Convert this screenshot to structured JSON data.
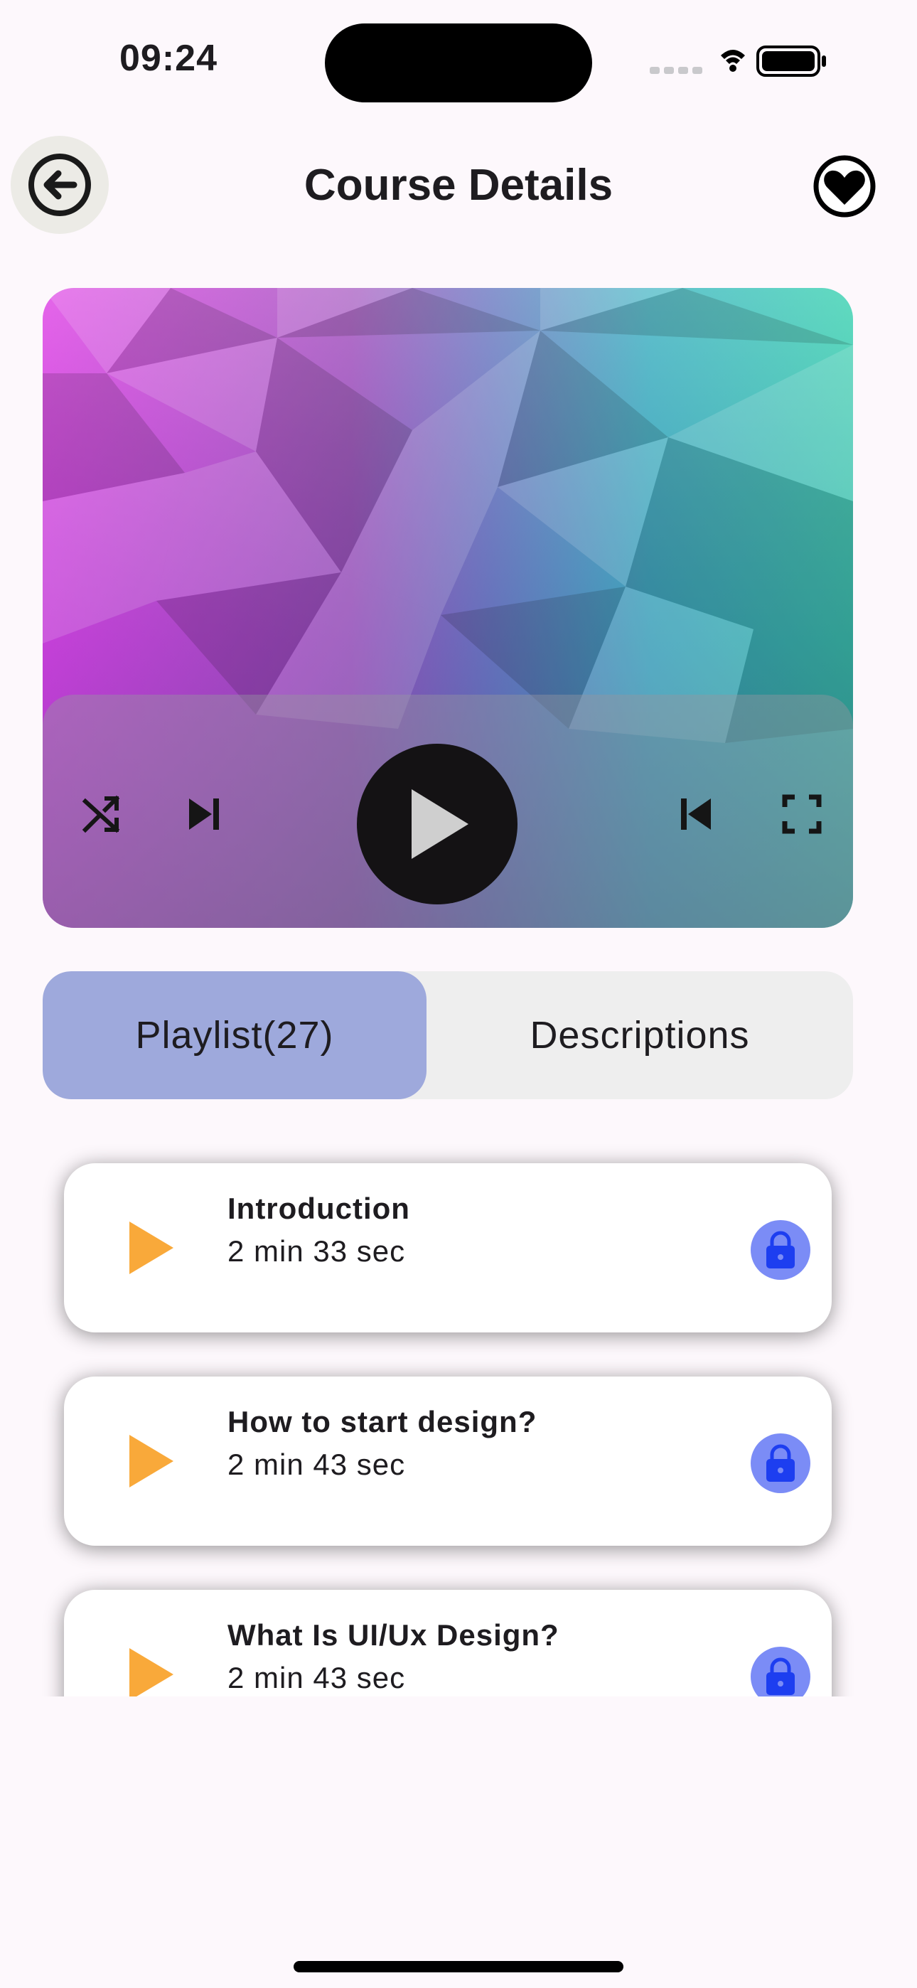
{
  "status_bar": {
    "time": "09:24"
  },
  "header": {
    "title": "Course Details"
  },
  "tabs": [
    {
      "label": "Playlist(27)",
      "active": true
    },
    {
      "label": "Descriptions",
      "active": false
    }
  ],
  "lessons": [
    {
      "title": "Introduction",
      "duration": "2 min 33 sec",
      "locked": true
    },
    {
      "title": "How to start design?",
      "duration": "2 min 43 sec",
      "locked": true
    },
    {
      "title": "What Is UI/Ux Design?",
      "duration": "2 min 43 sec",
      "locked": true
    }
  ],
  "icons": {
    "back": "arrow-left-circle-icon",
    "favorite": "heart-icon",
    "shuffle": "shuffle-icon",
    "skip_next": "skip-next-icon",
    "play": "play-icon",
    "skip_previous": "skip-previous-icon",
    "fullscreen": "fullscreen-icon",
    "lock": "lock-icon"
  },
  "colors": {
    "background": "#fdf8fc",
    "tab_active": "#9ea9dc",
    "tab_inactive": "#eeeeee",
    "lesson_play": "#f9a93a",
    "lock_circle": "#7b8cf6",
    "lock_icon": "#1d3ef0"
  }
}
